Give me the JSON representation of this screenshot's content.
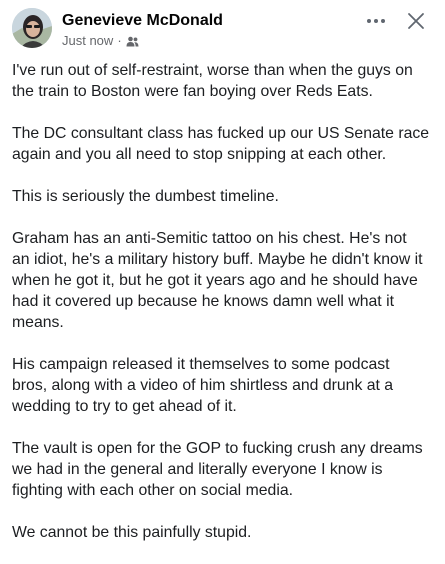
{
  "post": {
    "author": "Genevieve McDonald",
    "time": "Just now",
    "separator": "·",
    "audience_icon": "friends-icon",
    "more_icon": "more-options-icon",
    "close_icon": "close-icon",
    "paragraphs": [
      "I've run out of self-restraint, worse than when the guys on\nthe train to Boston were fan boying over Reds Eats.",
      "The DC consultant class has fucked up our US Senate race\nagain and you all need to stop snipping at each other.",
      "This is seriously the dumbest timeline.",
      "Graham has an anti-Semitic tattoo on his chest. He's not\nan idiot, he's a military history buff. Maybe he didn't know it\nwhen he got it, but he got it years ago and he should have\nhad it covered up because he knows damn well what it\nmeans.",
      "His campaign released it themselves to some podcast\nbros, along with a video of him shirtless and drunk at a\nwedding to try to get ahead of it.",
      "The vault is open for the GOP to fucking crush any dreams\nwe had in the general and literally everyone I know is\nfighting with each other on social media.",
      "We cannot be this painfully stupid."
    ]
  },
  "colors": {
    "text": "#1c1e21",
    "secondary_text": "#65676b",
    "background": "#ffffff"
  }
}
